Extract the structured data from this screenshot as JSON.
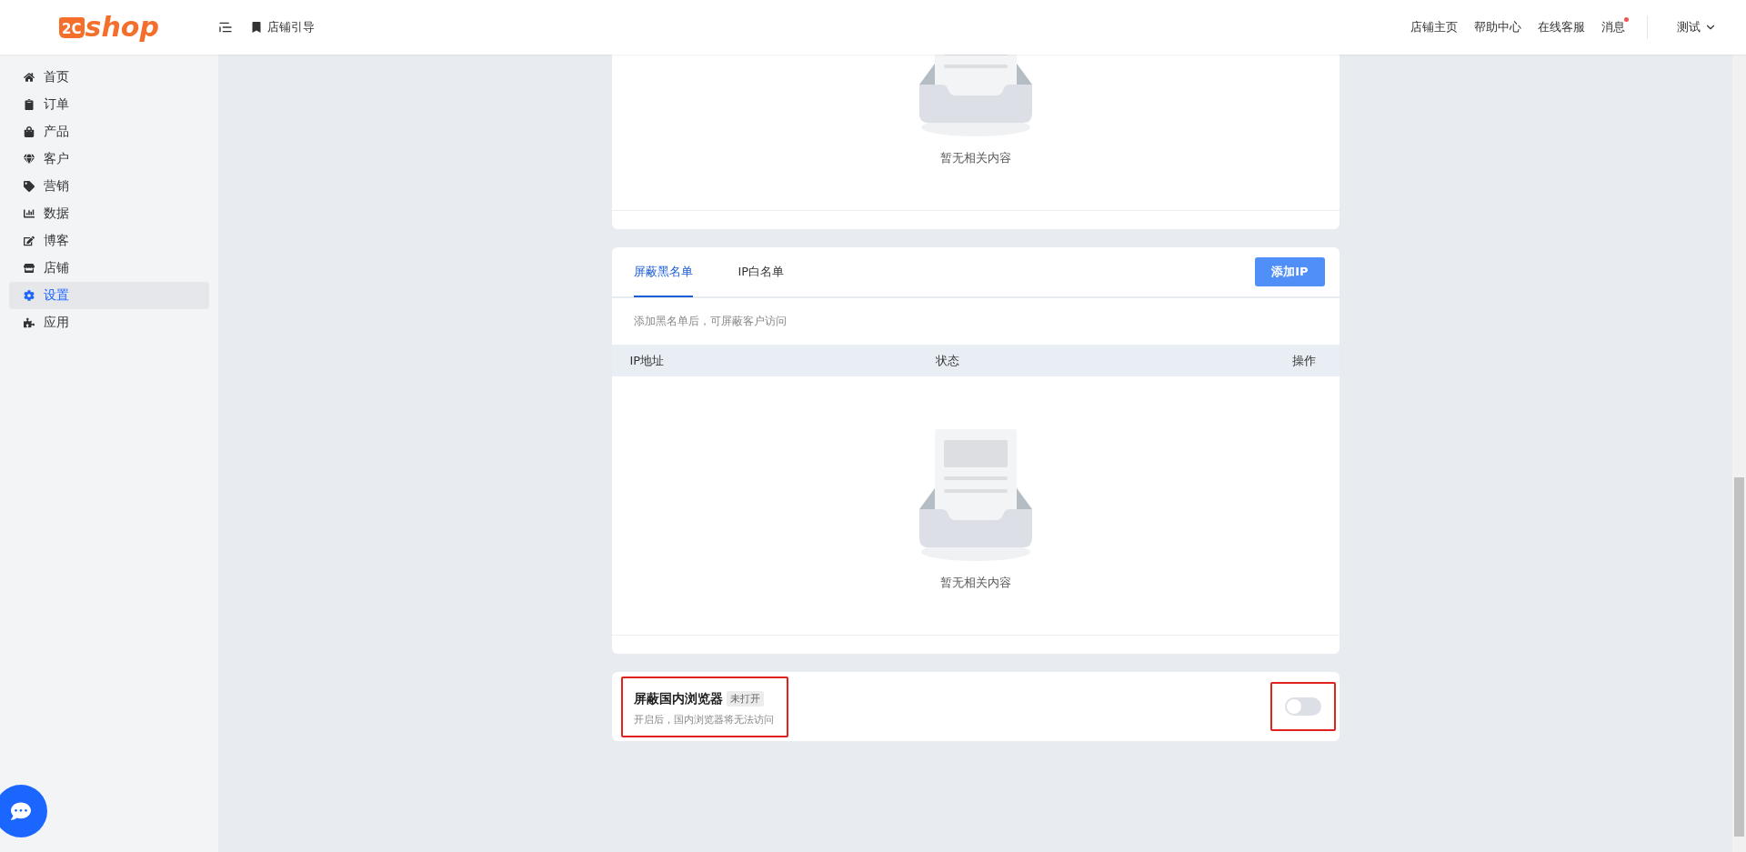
{
  "header": {
    "logo_mark": "2C",
    "logo_text": "shop",
    "guide_link": "店铺引导",
    "links": [
      "店铺主页",
      "帮助中心",
      "在线客服"
    ],
    "messages": {
      "label": "消息",
      "unread": true
    },
    "user": "测试"
  },
  "sidebar": {
    "items": [
      {
        "label": "首页",
        "selected": false
      },
      {
        "label": "订单",
        "selected": false
      },
      {
        "label": "产品",
        "selected": false
      },
      {
        "label": "客户",
        "selected": false
      },
      {
        "label": "营销",
        "selected": false
      },
      {
        "label": "数据",
        "selected": false
      },
      {
        "label": "博客",
        "selected": false
      },
      {
        "label": "店铺",
        "selected": false
      },
      {
        "label": "设置",
        "selected": true
      },
      {
        "label": "应用",
        "selected": false
      }
    ]
  },
  "top_card": {
    "empty_text": "暂无相关内容"
  },
  "ip_card": {
    "tabs": [
      {
        "label": "屏蔽黑名单",
        "selected": true
      },
      {
        "label": "IP白名单",
        "selected": false
      }
    ],
    "add_button": "添加IP",
    "hint": "添加黑名单后，可屏蔽客户访问",
    "table": {
      "columns": [
        "IP地址",
        "状态",
        "操作"
      ],
      "empty_text": "暂无相关内容"
    }
  },
  "browser_block": {
    "title": "屏蔽国内浏览器",
    "status": "未打开",
    "description": "开启后，国内浏览器将无法访问",
    "on": false,
    "highlighted": true
  }
}
